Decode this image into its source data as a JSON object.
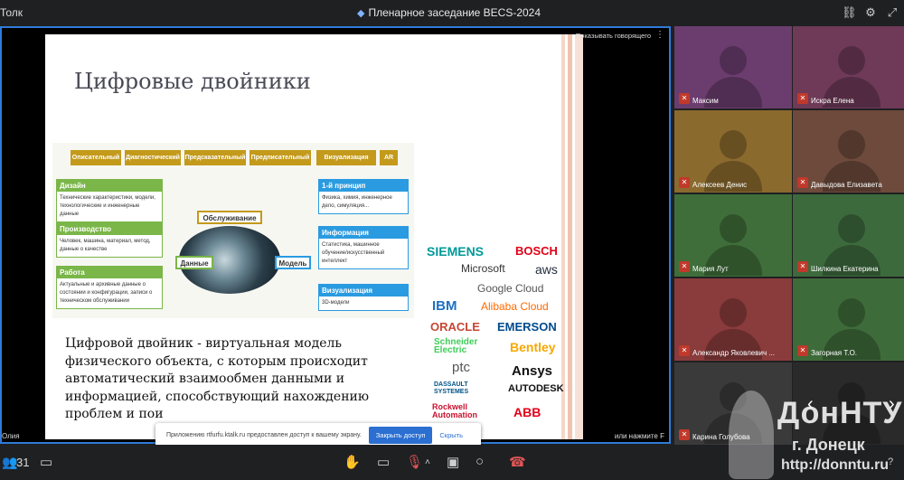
{
  "topbar": {
    "app_name": "Толк",
    "meeting_title": "Пленарное заседание BECS-2024",
    "icons": [
      "link-icon",
      "gear-icon",
      "fullscreen-icon"
    ]
  },
  "stage": {
    "speaker_view_label": "Показывать говорящего",
    "presenter_name": "Олия",
    "hint": "или нажмите F"
  },
  "slide": {
    "title": "Цифровые двойники",
    "top_row": [
      "Описательный",
      "Диагностический",
      "Предсказательный",
      "Предписательный",
      "Визуализация",
      "AR"
    ],
    "left_boxes": [
      {
        "header": "Дизайн",
        "text": "Технические характеристики, модели, технологические и инженерные данные"
      },
      {
        "header": "Производство",
        "text": "Человек, машина, материал, метод, данные о качестве"
      },
      {
        "header": "Работа",
        "text": "Актуальные и архивные данные о состоянии и конфигурации, записи о техническом обслуживании"
      }
    ],
    "right_boxes": [
      {
        "header": "1-й принцип",
        "text": "Физика, химия, инженерное дело, симуляция..."
      },
      {
        "header": "Информация",
        "text": "Статистика, машинное обучение/искусственный интеллект"
      },
      {
        "header": "Визуализация",
        "text": "3D-модели"
      }
    ],
    "center_labels": {
      "top": "Обслуживание",
      "left": "Данные",
      "right": "Модель"
    },
    "body": "Цифровой двойник - виртуальная модель физического объекта, с которым происходит автоматический взаимообмен данными и информацией, способствующий нахождению проблем и пои",
    "logos": [
      "SIEMENS",
      "BOSCH",
      "Microsoft",
      "aws",
      "Google Cloud",
      "IBM",
      "Alibaba Cloud",
      "ORACLE",
      "EMERSON",
      "Schneider Electric",
      "Bentley",
      "ptc",
      "Ansys",
      "DASSAULT SYSTEMES",
      "AUTODESK",
      "Rockwell Automation",
      "ABB"
    ]
  },
  "notice": {
    "text": "Приложению rtfurfu.ktalk.ru предоставлен доступ к вашему экрану.",
    "close_button": "Закрыть доступ",
    "hide_link": "Скрыть"
  },
  "participants": [
    {
      "name": "Максим",
      "color": "#6b3d6e"
    },
    {
      "name": "Искра Елена",
      "color": "#6e3a58"
    },
    {
      "name": "Алексеев Денис",
      "color": "#8b6a2e"
    },
    {
      "name": "Давыдова Елизавета",
      "color": "#6d4a3b"
    },
    {
      "name": "Мария Лут",
      "color": "#3f6e3a"
    },
    {
      "name": "Шилкина Екатерина",
      "color": "#3c6a3d"
    },
    {
      "name": "Александр Яковлевич ...",
      "color": "#8a3b3b"
    },
    {
      "name": "Загорная Т.О.",
      "color": "#3e6b3a"
    },
    {
      "name": "Карина Голубова",
      "color": "#3a3a3a"
    },
    {
      "name": "",
      "color": "#2a2a2a"
    }
  ],
  "bottombar": {
    "participant_count": "31",
    "help": "?"
  },
  "watermark": {
    "name": "ДонНТУ",
    "city": "г. Донецк",
    "url": "http://donntu.ru"
  }
}
